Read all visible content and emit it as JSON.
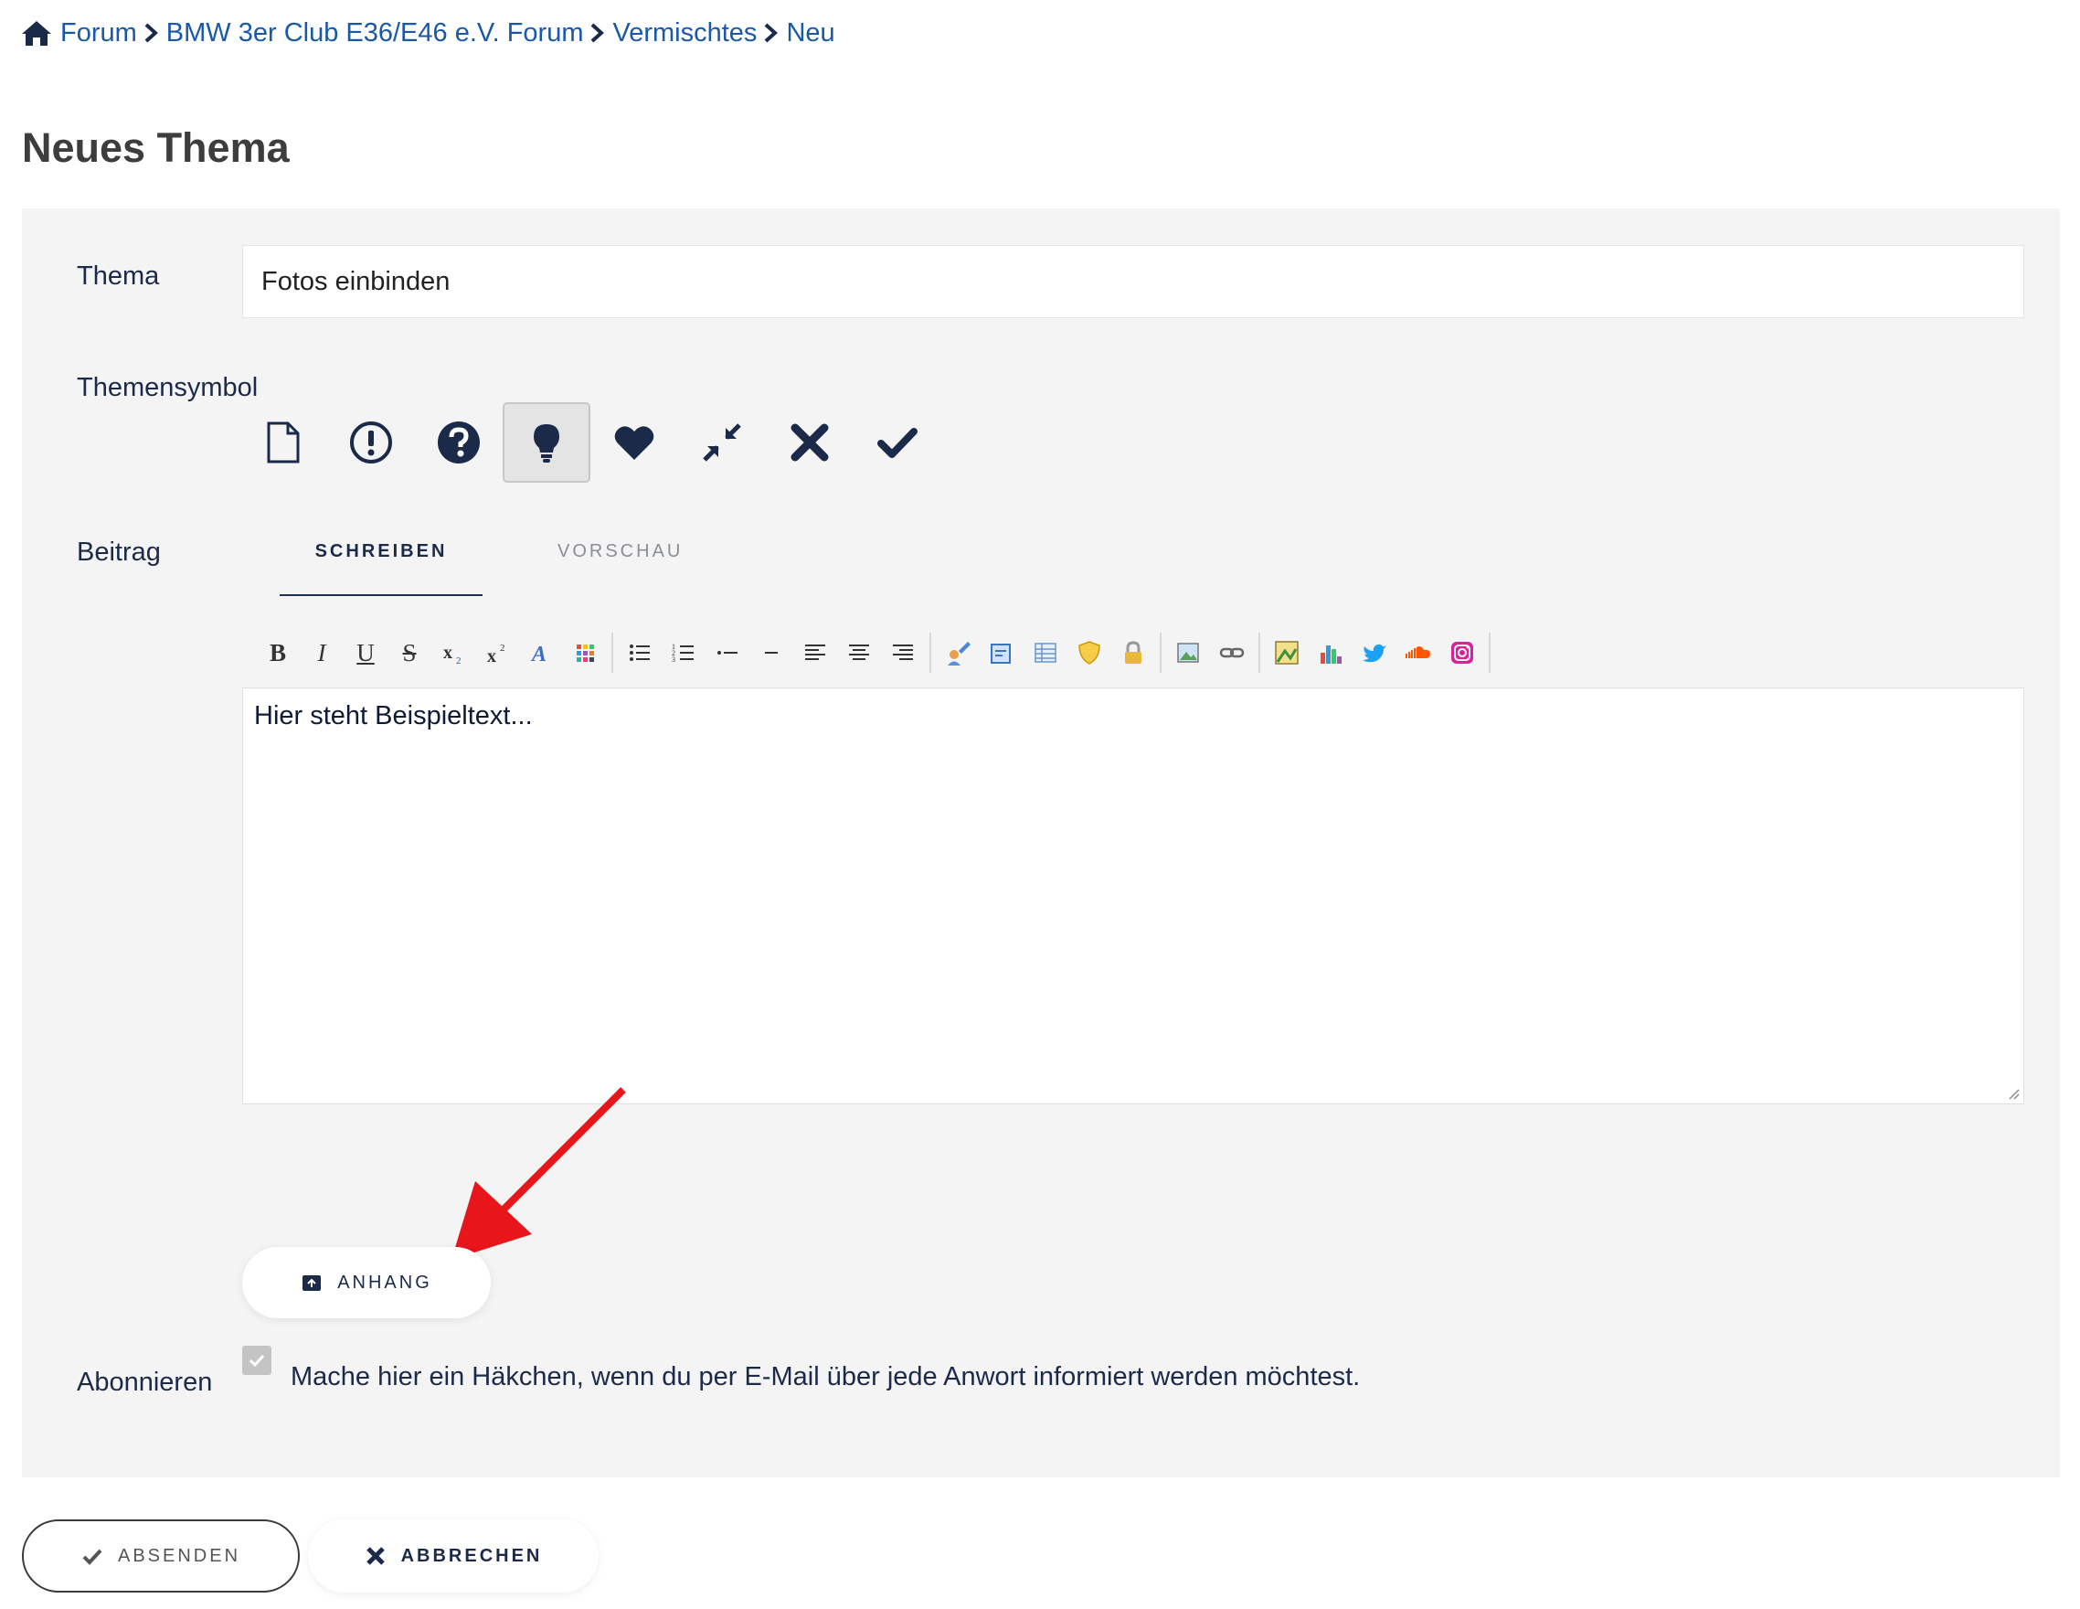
{
  "breadcrumb": {
    "items": [
      "Forum",
      "BMW 3er Club E36/E46 e.V. Forum",
      "Vermischtes",
      "Neu"
    ]
  },
  "page_title": "Neues Thema",
  "form": {
    "thema_label": "Thema",
    "thema_value": "Fotos einbinden",
    "symbol_label": "Themensymbol",
    "symbols": [
      "document-icon",
      "exclamation-circle-icon",
      "question-circle-icon",
      "lightbulb-icon",
      "heart-icon",
      "compress-icon",
      "x-icon",
      "check-icon"
    ],
    "selected_symbol": "lightbulb-icon",
    "beitrag_label": "Beitrag",
    "tabs": [
      "SCHREIBEN",
      "VORSCHAU"
    ],
    "active_tab": "SCHREIBEN",
    "editor_text": "Hier steht Beispieltext...",
    "attach_label": "ANHANG",
    "subscribe_label": "Abonnieren",
    "subscribe_text": "Mache hier ein Häkchen, wenn du per E-Mail über jede Anwort informiert werden möchtest.",
    "subscribe_checked": true
  },
  "toolbar": {
    "buttons": [
      "bold",
      "italic",
      "underline",
      "strikethrough",
      "subscript",
      "superscript",
      "font",
      "color",
      "bullet-list",
      "numbered-list",
      "list-item",
      "horizontal-rule",
      "align-left",
      "align-center",
      "align-right",
      "spoiler",
      "quote",
      "table",
      "hide",
      "lock",
      "image",
      "link",
      "gallery",
      "chart",
      "twitter",
      "soundcloud",
      "instagram"
    ]
  },
  "actions": {
    "submit_label": "ABSENDEN",
    "cancel_label": "ABBRECHEN"
  },
  "colors": {
    "link": "#1a58a8",
    "text": "#1c2a4a",
    "panel_bg": "#f4f4f4",
    "arrow": "#e8151b"
  }
}
